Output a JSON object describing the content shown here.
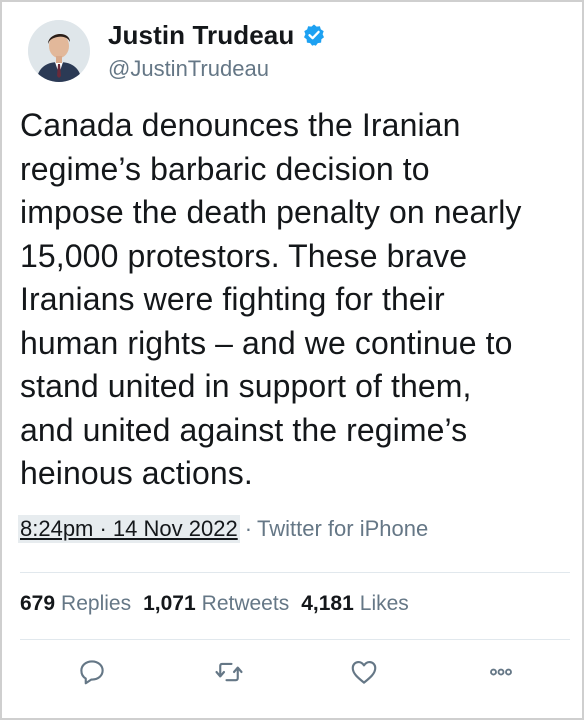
{
  "author": {
    "display_name": "Justin Trudeau",
    "handle": "@JustinTrudeau",
    "verified": true,
    "avatar_icon": "profile-photo"
  },
  "tweet": {
    "lines": [
      "Canada denounces the Iranian",
      "regime’s barbaric decision to",
      "impose the death penalty on nearly",
      "15,000 protestors. These brave",
      "Iranians were fighting for their",
      "human rights – and we continue to",
      "stand united in support of them,",
      "and united against the regime’s",
      "heinous actions."
    ]
  },
  "meta": {
    "timestamp": "8:24pm · 14 Nov 2022",
    "separator": "·",
    "source": "Twitter for iPhone"
  },
  "stats": {
    "replies_count": "679",
    "replies_label": "Replies",
    "retweets_count": "1,071",
    "retweets_label": "Retweets",
    "likes_count": "4,181",
    "likes_label": "Likes"
  },
  "actions": {
    "reply_icon": "reply-icon",
    "retweet_icon": "retweet-icon",
    "like_icon": "heart-icon",
    "more_icon": "more-icon"
  },
  "colors": {
    "text": "#14171a",
    "secondary": "#657786",
    "verified_blue": "#1da1f2",
    "divider": "#e1e8ed"
  }
}
